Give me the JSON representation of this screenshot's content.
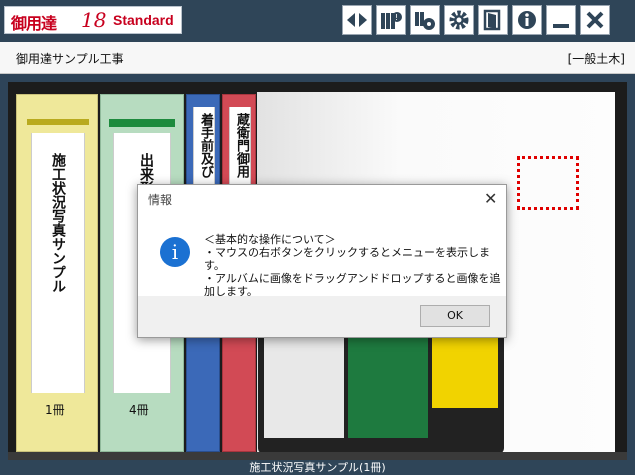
{
  "app": {
    "logo_name": "御用達",
    "logo_version": "18",
    "logo_edition": "Standard"
  },
  "toolbar": {
    "buttons": [
      {
        "name": "prev-next-arrows-icon"
      },
      {
        "name": "photo-info-icon"
      },
      {
        "name": "photo-settings-icon"
      },
      {
        "name": "gear-icon"
      },
      {
        "name": "open-book-icon"
      },
      {
        "name": "info-icon"
      },
      {
        "name": "minimize-icon"
      },
      {
        "name": "close-icon"
      }
    ]
  },
  "project": {
    "name": "御用達サンプル工事",
    "category": "[一般土木]"
  },
  "binders": [
    {
      "title": "施工状況写真サンプル",
      "count": "1冊",
      "color": "#efe89a"
    },
    {
      "title": "出来形管理写真",
      "count": "4冊",
      "color": "#b7dcc0"
    },
    {
      "title": "着手前及び",
      "count": "",
      "color": "#3b69b8"
    },
    {
      "title": "蔵衛門御用",
      "count": "",
      "color": "#d24a55"
    }
  ],
  "dialog": {
    "title": "情報",
    "close_glyph": "✕",
    "icon_glyph": "i",
    "message_line1": "＜基本的な操作について＞",
    "message_line2": "・マウスの右ボタンをクリックするとメニューを表示します。",
    "message_line3": "・アルバムに画像をドラッグアンドドロップすると画像を追加します。",
    "ok_label": "OK"
  },
  "status": {
    "text": "施工状況写真サンプル(1冊)"
  },
  "colors": {
    "titlebar": "#2f4558",
    "accent_red": "#c8001e",
    "info_blue": "#1b71d2"
  }
}
